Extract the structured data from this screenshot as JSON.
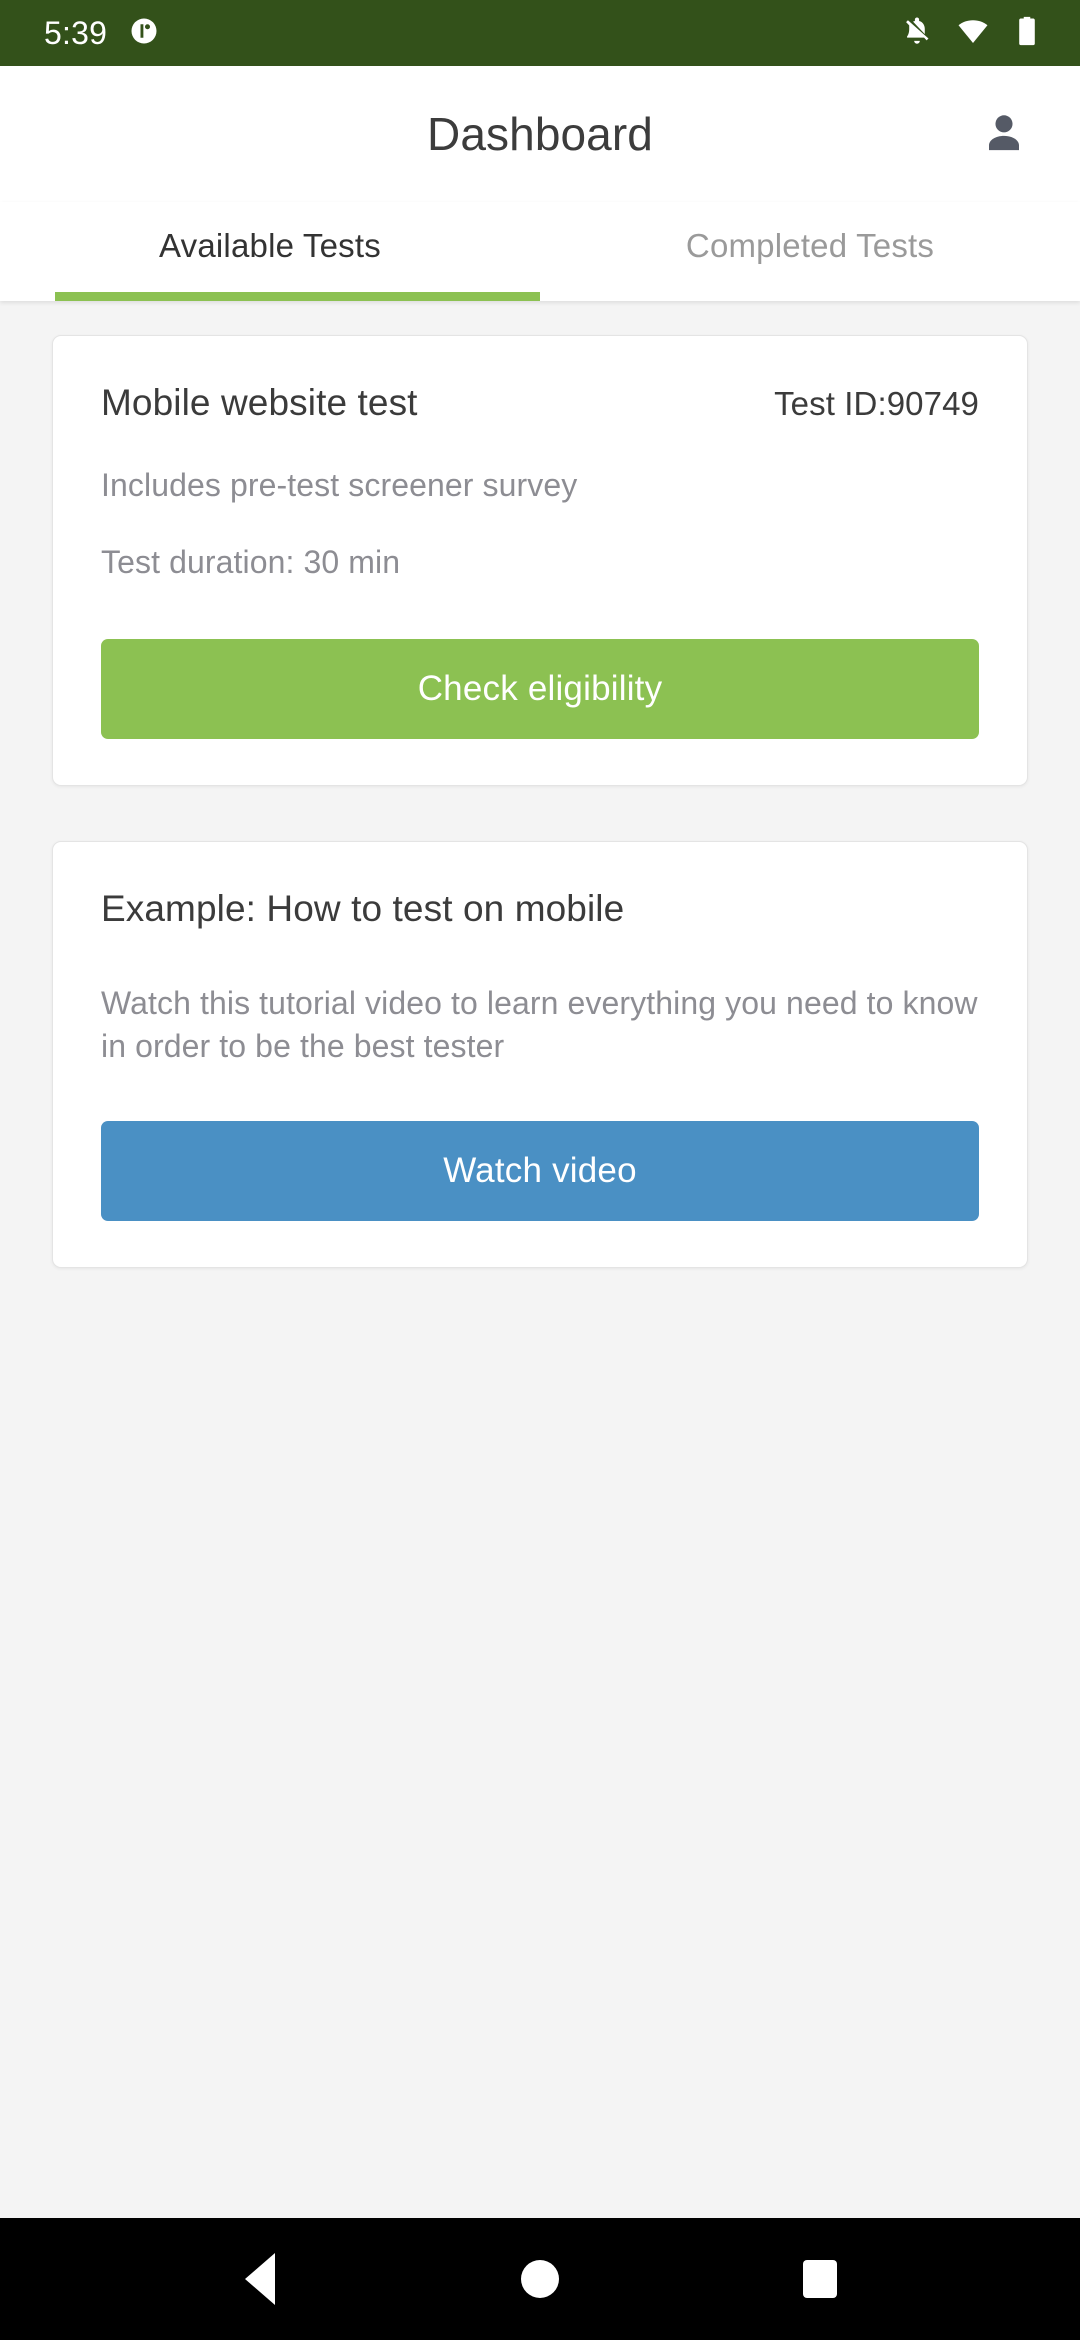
{
  "status_bar": {
    "time": "5:39",
    "background_color": "#33511a",
    "icons": [
      "app-notification-icon",
      "notifications-silenced-icon",
      "wifi-icon",
      "battery-icon"
    ]
  },
  "app_bar": {
    "title": "Dashboard",
    "profile_icon": "person-icon"
  },
  "tabs": [
    {
      "label": "Available Tests",
      "active": true
    },
    {
      "label": "Completed Tests",
      "active": false
    }
  ],
  "tab_indicator_color": "#8cc152",
  "cards": [
    {
      "title": "Mobile website test",
      "test_id_label": "Test ID:90749",
      "line1": "Includes pre-test screener survey",
      "line2": "Test duration: 30 min",
      "button_label": "Check eligibility",
      "button_color": "#8cc152"
    },
    {
      "title": "Example: How to test on mobile",
      "description": "Watch this tutorial video to learn everything you need to know in order to be the best tester",
      "button_label": "Watch video",
      "button_color": "#4a90c4"
    }
  ],
  "nav_bar": {
    "back": "back-triangle-icon",
    "home": "home-circle-icon",
    "recents": "recents-square-icon"
  }
}
